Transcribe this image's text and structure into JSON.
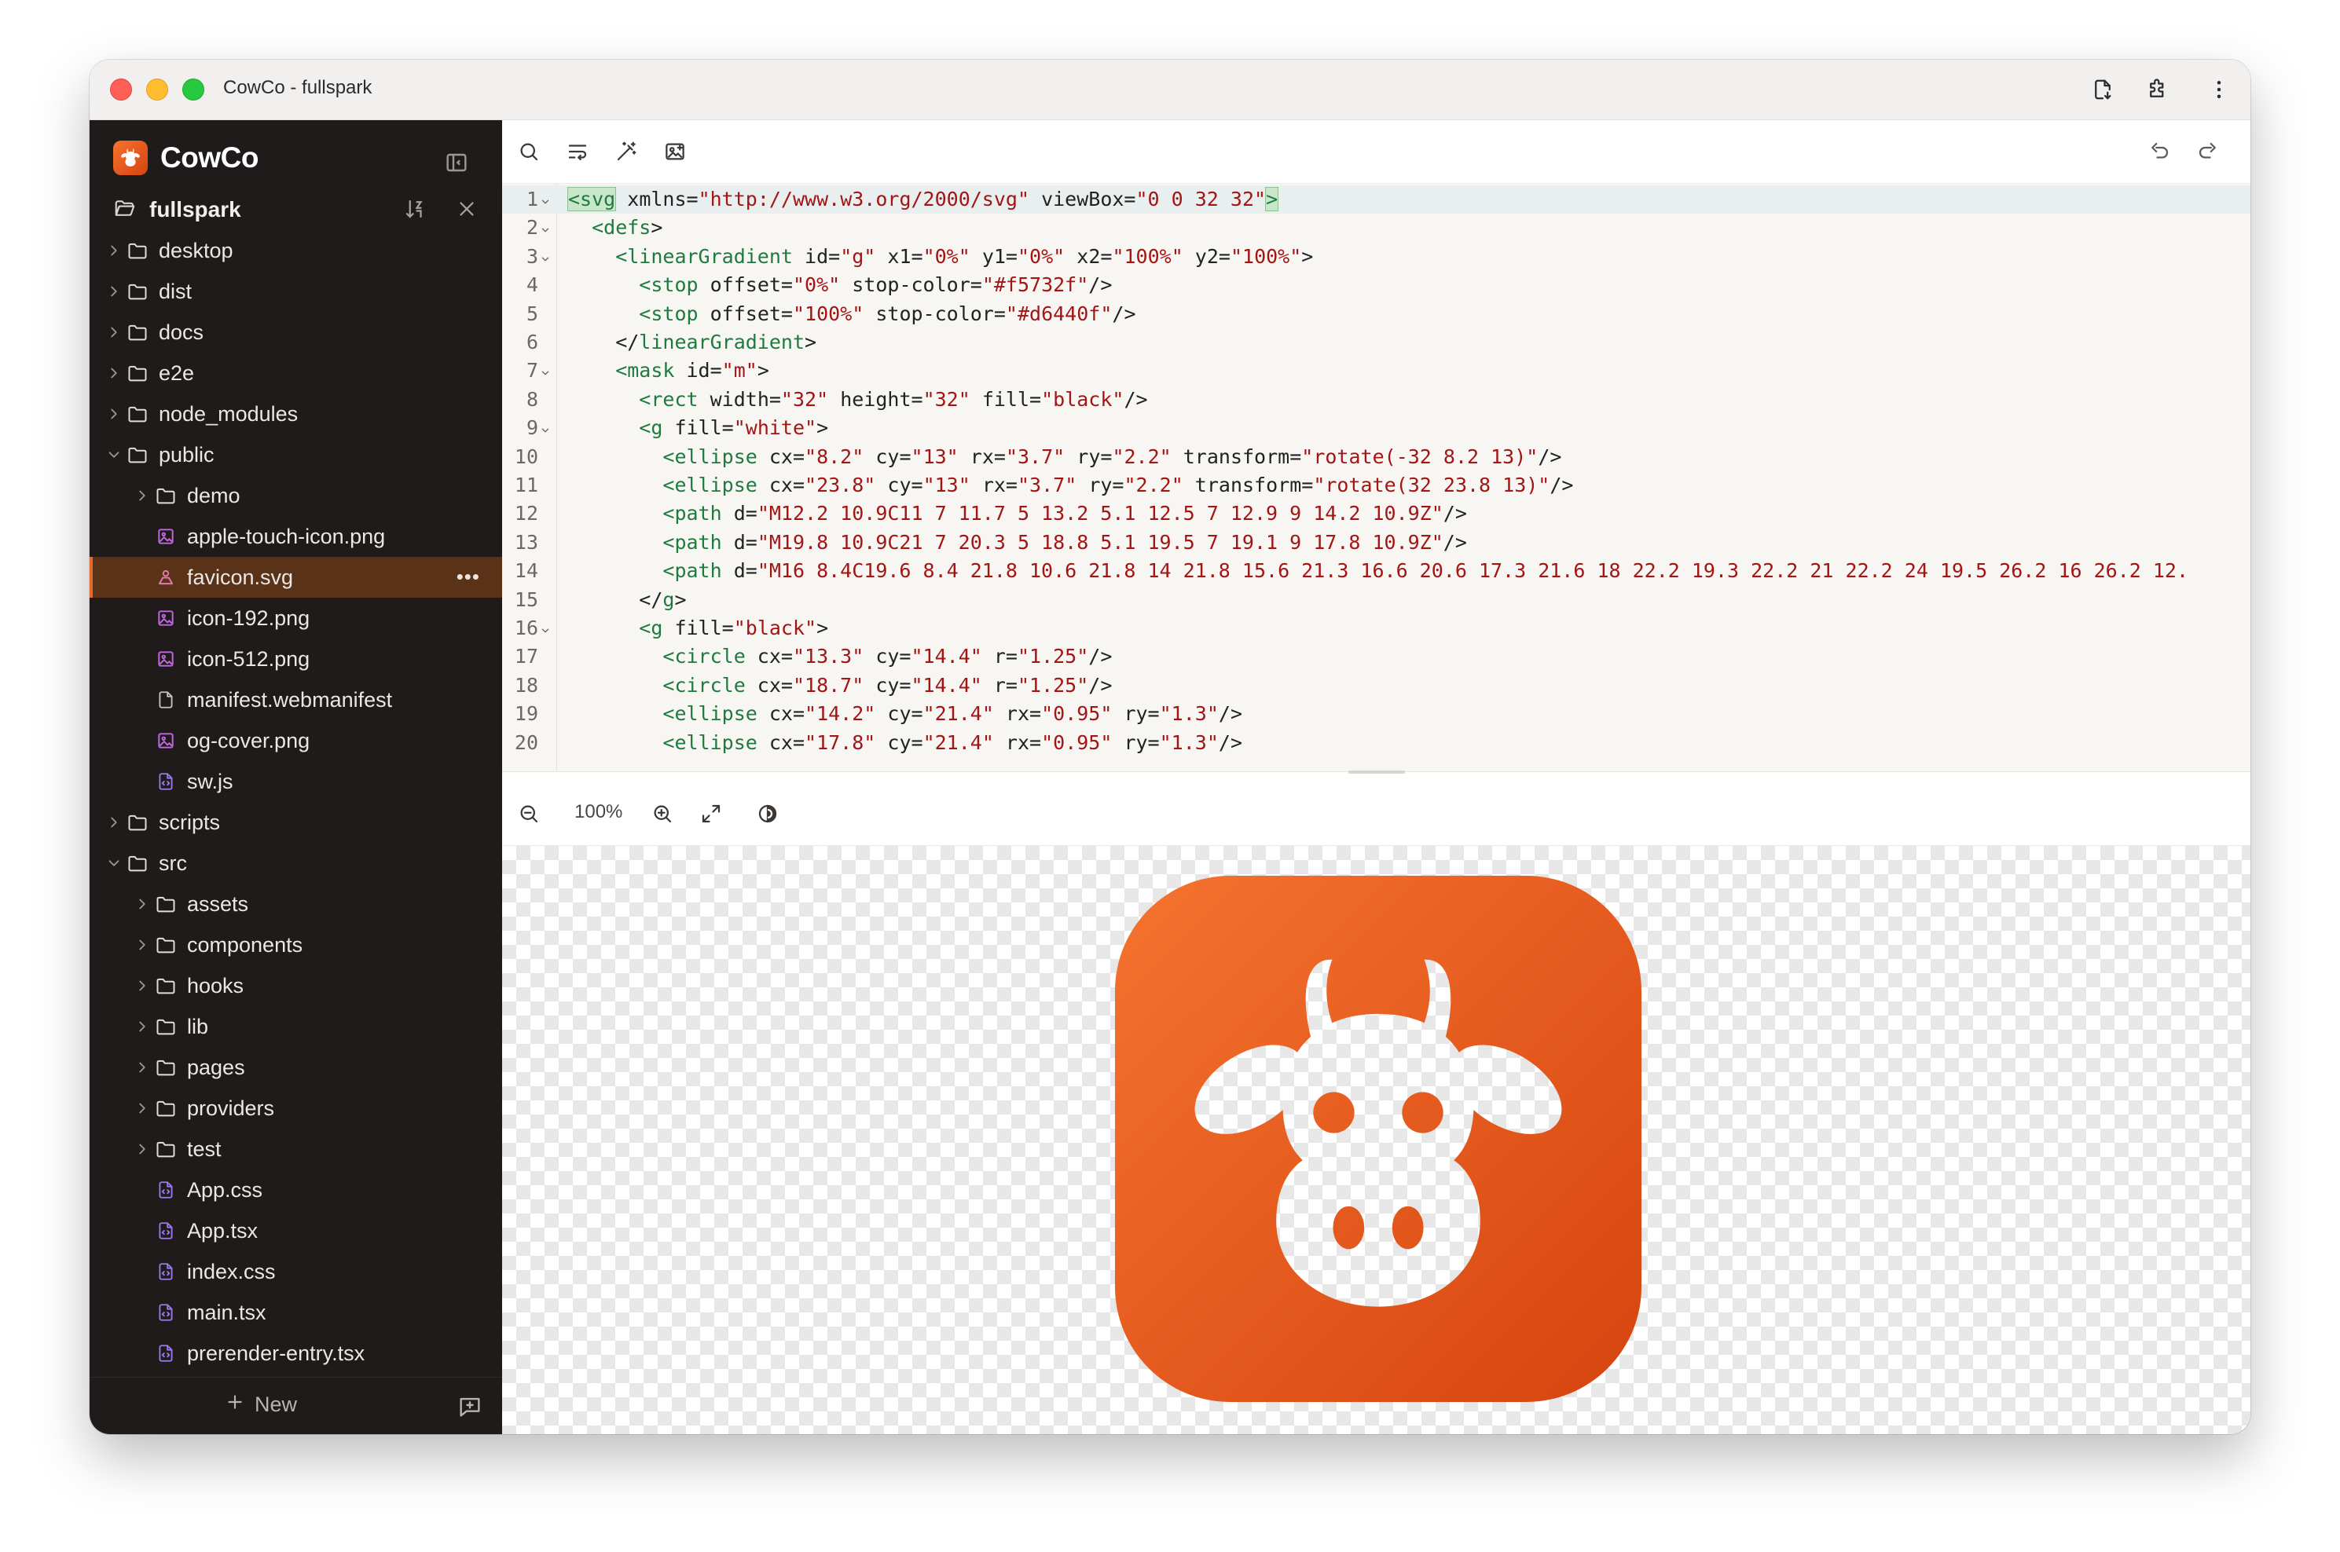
{
  "window": {
    "title": "CowCo - fullspark"
  },
  "sidebar": {
    "brand": "CowCo",
    "project": "fullspark",
    "tree": [
      {
        "label": "desktop",
        "type": "folder",
        "depth": 0,
        "expanded": false
      },
      {
        "label": "dist",
        "type": "folder",
        "depth": 0,
        "expanded": false
      },
      {
        "label": "docs",
        "type": "folder",
        "depth": 0,
        "expanded": false
      },
      {
        "label": "e2e",
        "type": "folder",
        "depth": 0,
        "expanded": false
      },
      {
        "label": "node_modules",
        "type": "folder",
        "depth": 0,
        "expanded": false
      },
      {
        "label": "public",
        "type": "folder",
        "depth": 0,
        "expanded": true
      },
      {
        "label": "demo",
        "type": "folder",
        "depth": 1,
        "expanded": false
      },
      {
        "label": "apple-touch-icon.png",
        "type": "image",
        "depth": 1
      },
      {
        "label": "favicon.svg",
        "type": "svg",
        "depth": 1,
        "selected": true
      },
      {
        "label": "icon-192.png",
        "type": "image",
        "depth": 1
      },
      {
        "label": "icon-512.png",
        "type": "image",
        "depth": 1
      },
      {
        "label": "manifest.webmanifest",
        "type": "file",
        "depth": 1
      },
      {
        "label": "og-cover.png",
        "type": "image",
        "depth": 1
      },
      {
        "label": "sw.js",
        "type": "code",
        "depth": 1
      },
      {
        "label": "scripts",
        "type": "folder",
        "depth": 0,
        "expanded": false
      },
      {
        "label": "src",
        "type": "folder",
        "depth": 0,
        "expanded": true
      },
      {
        "label": "assets",
        "type": "folder",
        "depth": 1,
        "expanded": false
      },
      {
        "label": "components",
        "type": "folder",
        "depth": 1,
        "expanded": false
      },
      {
        "label": "hooks",
        "type": "folder",
        "depth": 1,
        "expanded": false
      },
      {
        "label": "lib",
        "type": "folder",
        "depth": 1,
        "expanded": false
      },
      {
        "label": "pages",
        "type": "folder",
        "depth": 1,
        "expanded": false
      },
      {
        "label": "providers",
        "type": "folder",
        "depth": 1,
        "expanded": false
      },
      {
        "label": "test",
        "type": "folder",
        "depth": 1,
        "expanded": false
      },
      {
        "label": "App.css",
        "type": "code",
        "depth": 1
      },
      {
        "label": "App.tsx",
        "type": "code",
        "depth": 1
      },
      {
        "label": "index.css",
        "type": "code",
        "depth": 1
      },
      {
        "label": "main.tsx",
        "type": "code",
        "depth": 1
      },
      {
        "label": "prerender-entry.tsx",
        "type": "code",
        "depth": 1
      }
    ],
    "selected_more": "•••",
    "new_label": "New"
  },
  "editor": {
    "active_line": 1,
    "lines": [
      {
        "n": "1",
        "fold": true,
        "indent": 0,
        "parts": [
          [
            "t",
            "<svg"
          ],
          [
            "p",
            " xmlns="
          ],
          [
            "s",
            "\"http://www.w3.org/2000/svg\""
          ],
          [
            "p",
            " viewBox="
          ],
          [
            "s",
            "\"0 0 32 32\""
          ],
          [
            "t",
            ">"
          ]
        ]
      },
      {
        "n": "2",
        "fold": true,
        "indent": 1,
        "parts": [
          [
            "t",
            "<defs"
          ],
          [
            "p",
            ">"
          ]
        ]
      },
      {
        "n": "3",
        "fold": true,
        "indent": 2,
        "parts": [
          [
            "t",
            "<linearGradient"
          ],
          [
            "p",
            " id="
          ],
          [
            "s",
            "\"g\""
          ],
          [
            "p",
            " x1="
          ],
          [
            "s",
            "\"0%\""
          ],
          [
            "p",
            " y1="
          ],
          [
            "s",
            "\"0%\""
          ],
          [
            "p",
            " x2="
          ],
          [
            "s",
            "\"100%\""
          ],
          [
            "p",
            " y2="
          ],
          [
            "s",
            "\"100%\""
          ],
          [
            "p",
            ">"
          ]
        ]
      },
      {
        "n": "4",
        "fold": false,
        "indent": 3,
        "parts": [
          [
            "t",
            "<stop"
          ],
          [
            "p",
            " offset="
          ],
          [
            "s",
            "\"0%\""
          ],
          [
            "p",
            " stop-color="
          ],
          [
            "s",
            "\"#f5732f\""
          ],
          [
            "p",
            "/>"
          ]
        ]
      },
      {
        "n": "5",
        "fold": false,
        "indent": 3,
        "parts": [
          [
            "t",
            "<stop"
          ],
          [
            "p",
            " offset="
          ],
          [
            "s",
            "\"100%\""
          ],
          [
            "p",
            " stop-color="
          ],
          [
            "s",
            "\"#d6440f\""
          ],
          [
            "p",
            "/>"
          ]
        ]
      },
      {
        "n": "6",
        "fold": false,
        "indent": 2,
        "parts": [
          [
            "p",
            "</"
          ],
          [
            "t",
            "linearGradient"
          ],
          [
            "p",
            ">"
          ]
        ]
      },
      {
        "n": "7",
        "fold": true,
        "indent": 2,
        "parts": [
          [
            "t",
            "<mask"
          ],
          [
            "p",
            " id="
          ],
          [
            "s",
            "\"m\""
          ],
          [
            "p",
            ">"
          ]
        ]
      },
      {
        "n": "8",
        "fold": false,
        "indent": 3,
        "parts": [
          [
            "t",
            "<rect"
          ],
          [
            "p",
            " width="
          ],
          [
            "s",
            "\"32\""
          ],
          [
            "p",
            " height="
          ],
          [
            "s",
            "\"32\""
          ],
          [
            "p",
            " fill="
          ],
          [
            "s",
            "\"black\""
          ],
          [
            "p",
            "/>"
          ]
        ]
      },
      {
        "n": "9",
        "fold": true,
        "indent": 3,
        "parts": [
          [
            "t",
            "<g"
          ],
          [
            "p",
            " fill="
          ],
          [
            "s",
            "\"white\""
          ],
          [
            "p",
            ">"
          ]
        ]
      },
      {
        "n": "10",
        "fold": false,
        "indent": 4,
        "parts": [
          [
            "t",
            "<ellipse"
          ],
          [
            "p",
            " cx="
          ],
          [
            "s",
            "\"8.2\""
          ],
          [
            "p",
            " cy="
          ],
          [
            "s",
            "\"13\""
          ],
          [
            "p",
            " rx="
          ],
          [
            "s",
            "\"3.7\""
          ],
          [
            "p",
            " ry="
          ],
          [
            "s",
            "\"2.2\""
          ],
          [
            "p",
            " transform="
          ],
          [
            "s",
            "\"rotate(-32 8.2 13)\""
          ],
          [
            "p",
            "/>"
          ]
        ]
      },
      {
        "n": "11",
        "fold": false,
        "indent": 4,
        "parts": [
          [
            "t",
            "<ellipse"
          ],
          [
            "p",
            " cx="
          ],
          [
            "s",
            "\"23.8\""
          ],
          [
            "p",
            " cy="
          ],
          [
            "s",
            "\"13\""
          ],
          [
            "p",
            " rx="
          ],
          [
            "s",
            "\"3.7\""
          ],
          [
            "p",
            " ry="
          ],
          [
            "s",
            "\"2.2\""
          ],
          [
            "p",
            " transform="
          ],
          [
            "s",
            "\"rotate(32 23.8 13)\""
          ],
          [
            "p",
            "/>"
          ]
        ]
      },
      {
        "n": "12",
        "fold": false,
        "indent": 4,
        "parts": [
          [
            "t",
            "<path"
          ],
          [
            "p",
            " d="
          ],
          [
            "s",
            "\"M12.2 10.9C11 7 11.7 5 13.2 5.1 12.5 7 12.9 9 14.2 10.9Z\""
          ],
          [
            "p",
            "/>"
          ]
        ]
      },
      {
        "n": "13",
        "fold": false,
        "indent": 4,
        "parts": [
          [
            "t",
            "<path"
          ],
          [
            "p",
            " d="
          ],
          [
            "s",
            "\"M19.8 10.9C21 7 20.3 5 18.8 5.1 19.5 7 19.1 9 17.8 10.9Z\""
          ],
          [
            "p",
            "/>"
          ]
        ]
      },
      {
        "n": "14",
        "fold": false,
        "indent": 4,
        "parts": [
          [
            "t",
            "<path"
          ],
          [
            "p",
            " d="
          ],
          [
            "s",
            "\"M16 8.4C19.6 8.4 21.8 10.6 21.8 14 21.8 15.6 21.3 16.6 20.6 17.3 21.6 18 22.2 19.3 22.2 21 22.2 24 19.5 26.2 16 26.2 12."
          ]
        ]
      },
      {
        "n": "15",
        "fold": false,
        "indent": 3,
        "parts": [
          [
            "p",
            "</"
          ],
          [
            "t",
            "g"
          ],
          [
            "p",
            ">"
          ]
        ]
      },
      {
        "n": "16",
        "fold": true,
        "indent": 3,
        "parts": [
          [
            "t",
            "<g"
          ],
          [
            "p",
            " fill="
          ],
          [
            "s",
            "\"black\""
          ],
          [
            "p",
            ">"
          ]
        ]
      },
      {
        "n": "17",
        "fold": false,
        "indent": 4,
        "parts": [
          [
            "t",
            "<circle"
          ],
          [
            "p",
            " cx="
          ],
          [
            "s",
            "\"13.3\""
          ],
          [
            "p",
            " cy="
          ],
          [
            "s",
            "\"14.4\""
          ],
          [
            "p",
            " r="
          ],
          [
            "s",
            "\"1.25\""
          ],
          [
            "p",
            "/>"
          ]
        ]
      },
      {
        "n": "18",
        "fold": false,
        "indent": 4,
        "parts": [
          [
            "t",
            "<circle"
          ],
          [
            "p",
            " cx="
          ],
          [
            "s",
            "\"18.7\""
          ],
          [
            "p",
            " cy="
          ],
          [
            "s",
            "\"14.4\""
          ],
          [
            "p",
            " r="
          ],
          [
            "s",
            "\"1.25\""
          ],
          [
            "p",
            "/>"
          ]
        ]
      },
      {
        "n": "19",
        "fold": false,
        "indent": 4,
        "parts": [
          [
            "t",
            "<ellipse"
          ],
          [
            "p",
            " cx="
          ],
          [
            "s",
            "\"14.2\""
          ],
          [
            "p",
            " cy="
          ],
          [
            "s",
            "\"21.4\""
          ],
          [
            "p",
            " rx="
          ],
          [
            "s",
            "\"0.95\""
          ],
          [
            "p",
            " ry="
          ],
          [
            "s",
            "\"1.3\""
          ],
          [
            "p",
            "/>"
          ]
        ]
      },
      {
        "n": "20",
        "fold": false,
        "indent": 4,
        "parts": [
          [
            "t",
            "<ellipse"
          ],
          [
            "p",
            " cx="
          ],
          [
            "s",
            "\"17.8\""
          ],
          [
            "p",
            " cy="
          ],
          [
            "s",
            "\"21.4\""
          ],
          [
            "p",
            " rx="
          ],
          [
            "s",
            "\"0.95\""
          ],
          [
            "p",
            " ry="
          ],
          [
            "s",
            "\"1.3\""
          ],
          [
            "p",
            "/>"
          ]
        ]
      }
    ]
  },
  "preview": {
    "zoom": "100%"
  },
  "colors": {
    "accent": "#e4692a",
    "gradient_start": "#f5732f",
    "gradient_end": "#d6440f",
    "sidebar_bg": "#1e1b1a",
    "selected_row": "#5a3218"
  }
}
